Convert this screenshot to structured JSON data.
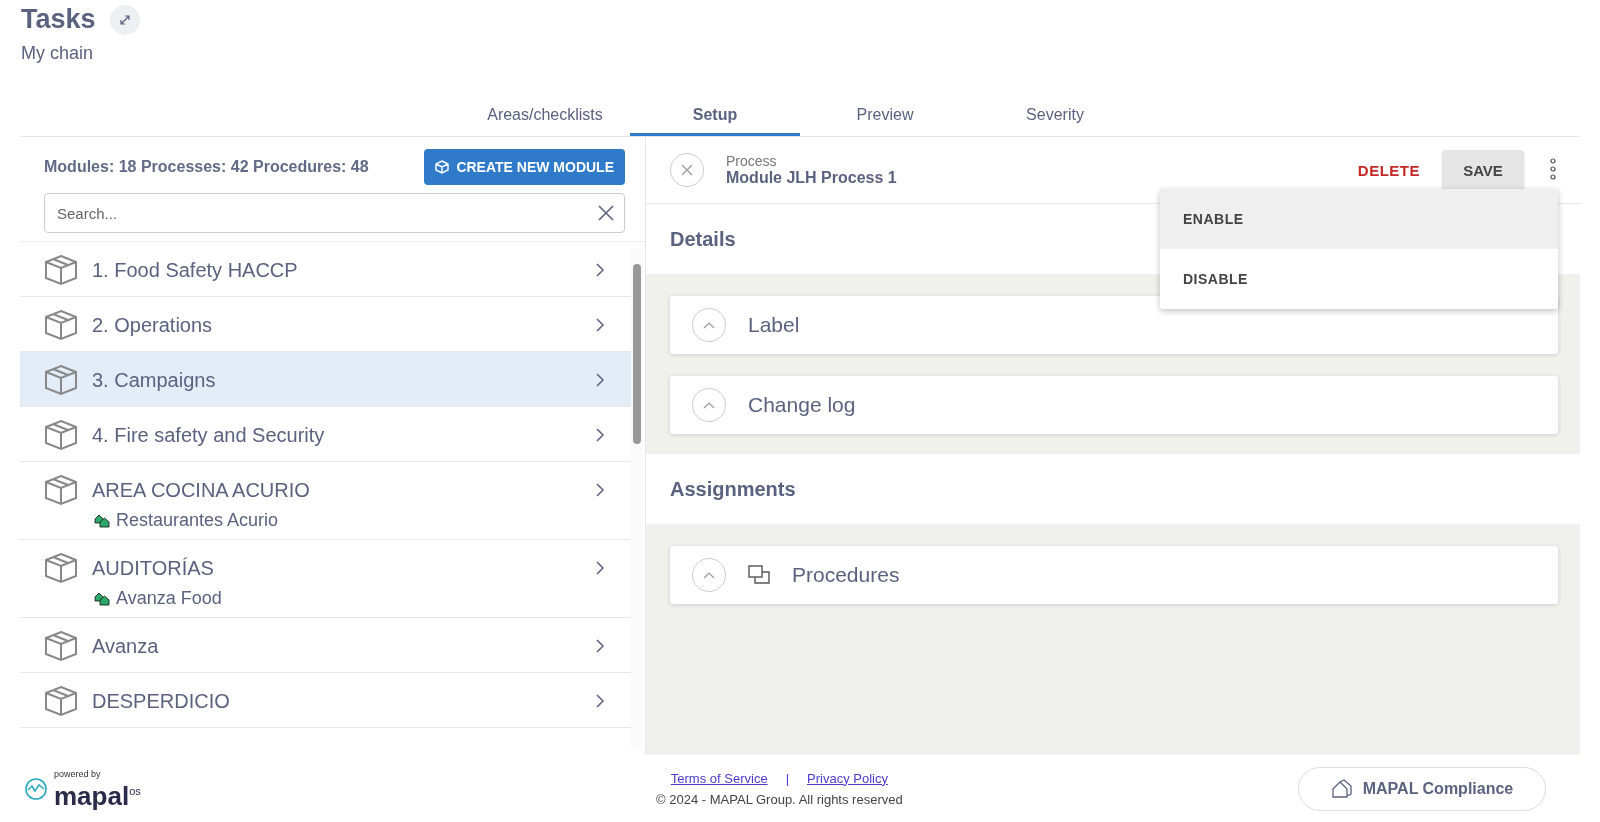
{
  "header": {
    "title": "Tasks",
    "subtitle": "My chain"
  },
  "tabs": [
    {
      "label": "Areas/checklists",
      "selected": false
    },
    {
      "label": "Setup",
      "selected": true
    },
    {
      "label": "Preview",
      "selected": false
    },
    {
      "label": "Severity",
      "selected": false
    }
  ],
  "modules_panel": {
    "counts": "Modules: 18 Processes: 42 Procedures: 48",
    "create_button": "CREATE NEW MODULE",
    "search": {
      "placeholder": "Search..."
    },
    "items": [
      {
        "name": "1. Food Safety HACCP",
        "selected": false
      },
      {
        "name": "2. Operations",
        "selected": false
      },
      {
        "name": "3. Campaigns",
        "selected": true
      },
      {
        "name": "4. Fire safety and Security",
        "selected": false
      },
      {
        "name": "AREA COCINA ACURIO",
        "location": "Restaurantes Acurio",
        "selected": false
      },
      {
        "name": "AUDITORÍAS",
        "location": "Avanza Food",
        "selected": false
      },
      {
        "name": "Avanza",
        "selected": false
      },
      {
        "name": "DESPERDICIO",
        "selected": false
      }
    ]
  },
  "process_panel": {
    "kind_label": "Process",
    "name": "Module JLH Process 1",
    "delete_button": "DELETE",
    "save_button": "SAVE",
    "menu": [
      {
        "label": "ENABLE",
        "selected": true
      },
      {
        "label": "DISABLE",
        "selected": false
      }
    ],
    "sections": [
      {
        "title": "Details",
        "cards": [
          {
            "label": "Label",
            "expanded": true
          },
          {
            "label": "Change log",
            "expanded": true
          }
        ]
      },
      {
        "title": "Assignments",
        "cards": [
          {
            "label": "Procedures",
            "expanded": true,
            "kind": "procedures"
          }
        ]
      }
    ]
  },
  "footer": {
    "powered_by": "powered by",
    "brand": "mapal",
    "brand_suffix": "os",
    "links": [
      "Terms of Service",
      "Privacy Policy"
    ],
    "separator": "|",
    "copyright": "© 2024 - MAPAL Group. All rights reserved",
    "compliance_button": "MAPAL Compliance"
  }
}
